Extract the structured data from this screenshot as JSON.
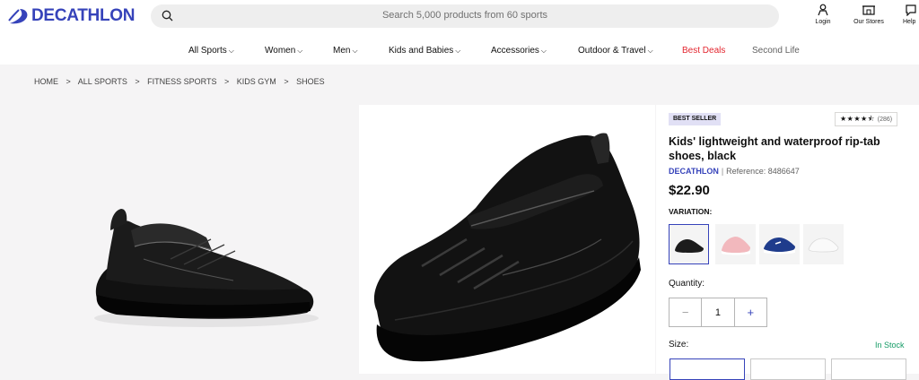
{
  "header": {
    "logo_text": "DECATHLON",
    "search_placeholder": "Search 5,000 products from 60 sports",
    "actions": [
      {
        "label": "Login",
        "icon": "user-icon"
      },
      {
        "label": "Our Stores",
        "icon": "store-icon"
      },
      {
        "label": "Help",
        "icon": "help-icon"
      }
    ]
  },
  "nav": {
    "items": [
      {
        "label": "All Sports",
        "chevron": "⌵"
      },
      {
        "label": "Women",
        "chevron": "⌵"
      },
      {
        "label": "Men",
        "chevron": "⌵"
      },
      {
        "label": "Kids and Babies",
        "chevron": "⌵"
      },
      {
        "label": "Accessories",
        "chevron": "⌵"
      },
      {
        "label": "Outdoor & Travel",
        "chevron": "⌵"
      },
      {
        "label": "Best Deals"
      },
      {
        "label": "Second Life"
      }
    ]
  },
  "breadcrumb": [
    "HOME",
    ">",
    "ALL SPORTS",
    ">",
    "FITNESS SPORTS",
    ">",
    "KIDS GYM",
    ">",
    "SHOES"
  ],
  "product": {
    "badge": "BEST SELLER",
    "rating_stars": "★★★★⯪",
    "rating_count": "(286)",
    "title": "Kids' lightweight and waterproof rip-tab shoes, black",
    "brand": "DECATHLON",
    "separator": "|",
    "reference": "Reference: 8486647",
    "price": "$22.90",
    "variation_label": "VARIATION:",
    "variations": [
      {
        "color": "black",
        "hex": "#1c1c1c"
      },
      {
        "color": "pink",
        "hex": "#f2b8bd"
      },
      {
        "color": "navy",
        "hex": "#1f3c8c"
      },
      {
        "color": "white",
        "hex": "#f2f2f2"
      }
    ],
    "quantity_label": "Quantity:",
    "quantity_minus": "−",
    "quantity_value": "1",
    "quantity_plus": "+",
    "size_label": "Size:",
    "stock_status": "In Stock"
  },
  "colors": {
    "brand": "#3643ba",
    "deals": "#e3262f",
    "stock": "#149b65"
  }
}
